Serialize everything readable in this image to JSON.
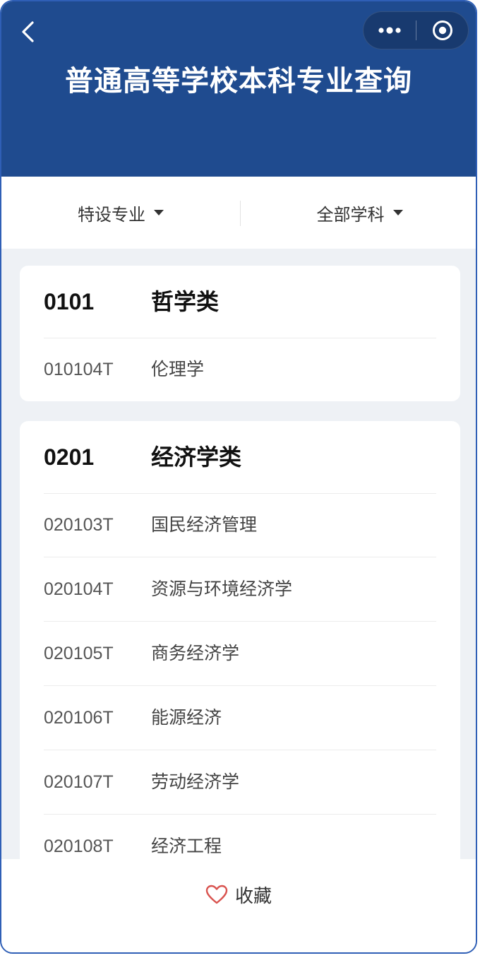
{
  "header": {
    "title": "普通高等学校本科专业查询",
    "back_icon": "chevron-left-icon",
    "more_icon": "more-dots-icon",
    "close_icon": "target-circle-icon",
    "bg_color": "#1f4b8f"
  },
  "filters": {
    "left_label": "特设专业",
    "right_label": "全部学科"
  },
  "categories": [
    {
      "code": "0101",
      "name": "哲学类",
      "majors": [
        {
          "code": "010104T",
          "name": "伦理学"
        }
      ]
    },
    {
      "code": "0201",
      "name": "经济学类",
      "majors": [
        {
          "code": "020103T",
          "name": "国民经济管理"
        },
        {
          "code": "020104T",
          "name": "资源与环境经济学"
        },
        {
          "code": "020105T",
          "name": "商务经济学"
        },
        {
          "code": "020106T",
          "name": "能源经济"
        },
        {
          "code": "020107T",
          "name": "劳动经济学"
        },
        {
          "code": "020108T",
          "name": "经济工程"
        }
      ]
    }
  ],
  "footer": {
    "favorite_label": "收藏",
    "favorite_icon": "heart-icon",
    "favorite_icon_color": "#d9534f"
  }
}
